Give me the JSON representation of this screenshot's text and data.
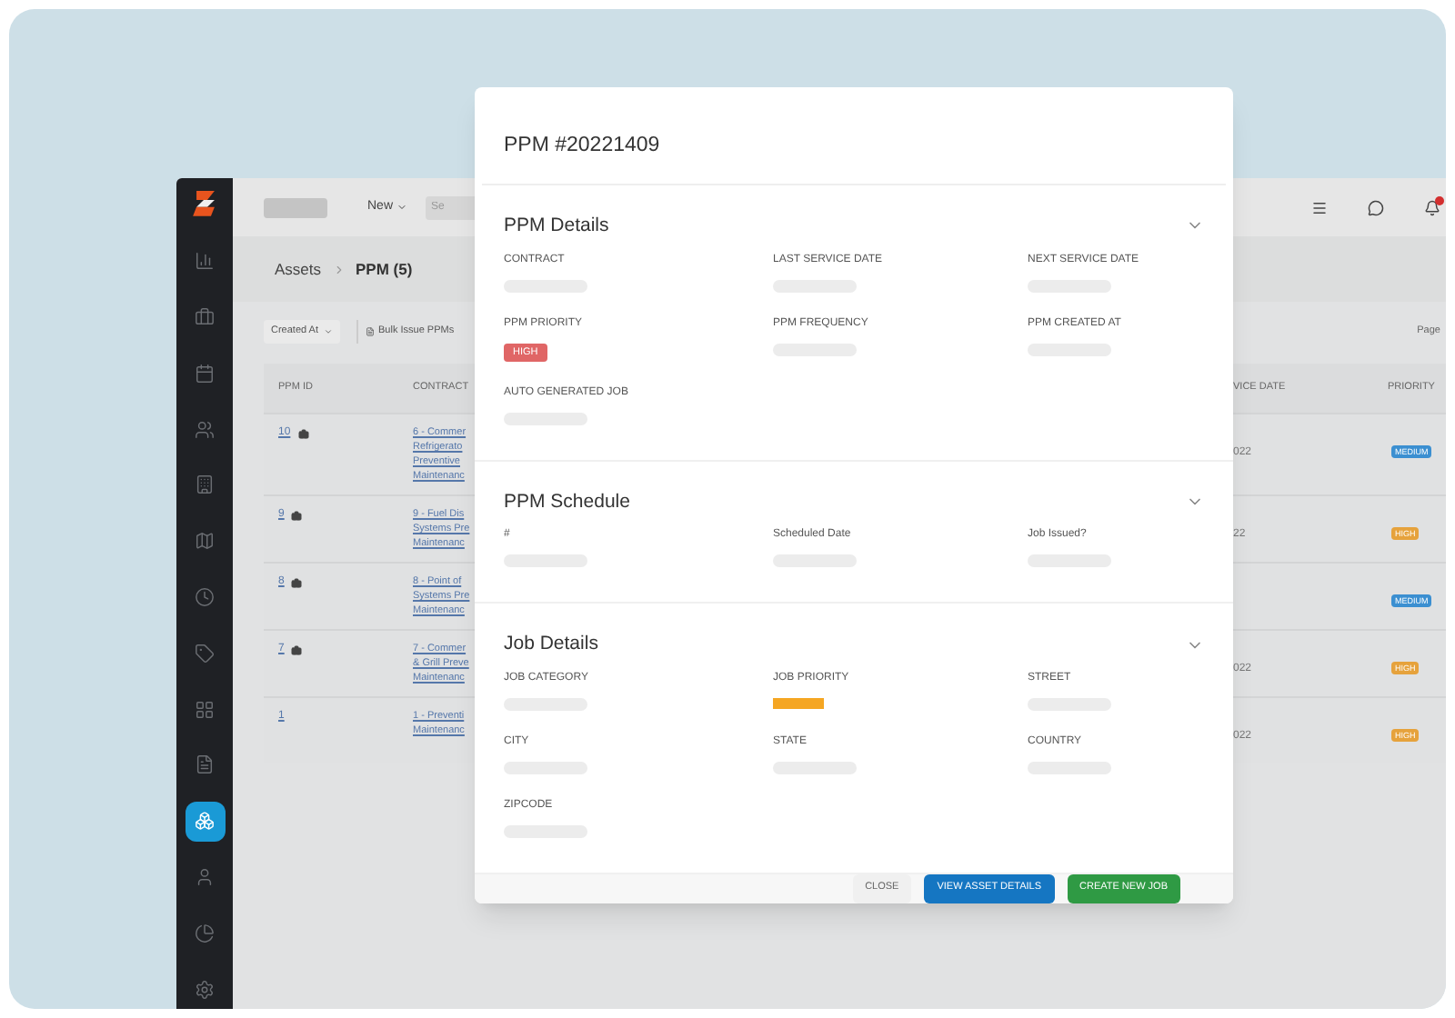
{
  "sidebar": {
    "items": [
      {
        "selected": false
      },
      {
        "selected": false
      },
      {
        "selected": false
      },
      {
        "selected": false
      },
      {
        "selected": false
      },
      {
        "selected": false
      },
      {
        "selected": false
      },
      {
        "selected": false
      },
      {
        "selected": false
      },
      {
        "selected": false
      },
      {
        "selected": true
      },
      {
        "selected": false
      },
      {
        "selected": false
      },
      {
        "selected": false
      }
    ]
  },
  "topbar": {
    "new_button": "New",
    "search": {
      "placeholder": "Se"
    }
  },
  "breadcrumb": [
    "Assets",
    "PPM (5)"
  ],
  "toolbar": {
    "filter": "Created At",
    "bulk_button": "Bulk Issue PPMs",
    "pagination_label": "Page"
  },
  "table": {
    "columns": [
      "PPM ID",
      "CONTRACT",
      "VICE DATE",
      "PRIORITY"
    ],
    "rows": [
      {
        "id": "10",
        "asset": true,
        "contract": [
          "6 - Commer",
          "Refrigerato",
          "Preventive",
          "Maintenanc"
        ],
        "date": "022",
        "priority": {
          "label": "MEDIUM",
          "color": "#3b8fd1"
        }
      },
      {
        "id": "9",
        "asset": true,
        "contract": [
          "9 - Fuel Dis",
          "Systems Pre",
          "Maintenanc"
        ],
        "date": "22",
        "priority": {
          "label": "HIGH",
          "color": "#e6a23c"
        }
      },
      {
        "id": "8",
        "asset": true,
        "contract": [
          "8 - Point of",
          "Systems Pre",
          "Maintenanc"
        ],
        "priority": {
          "label": "MEDIUM",
          "color": "#3b8fd1"
        }
      },
      {
        "id": "7",
        "asset": true,
        "contract": [
          "7 - Commer",
          "& Grill Preve",
          "Maintenanc"
        ],
        "date": "022",
        "priority": {
          "label": "HIGH",
          "color": "#e6a23c"
        }
      },
      {
        "id": "1",
        "asset": false,
        "contract": [
          "1 - Preventi",
          "Maintenanc"
        ],
        "date": "022",
        "priority": {
          "label": "HIGH",
          "color": "#e6a23c"
        }
      }
    ]
  },
  "modal": {
    "title": "PPM #20221409",
    "sections": [
      {
        "title": "PPM Details",
        "expanded": true,
        "fields": [
          {
            "label": "CONTRACT",
            "kind": "skeleton"
          },
          {
            "label": "LAST SERVICE DATE",
            "kind": "skeleton"
          },
          {
            "label": "NEXT SERVICE DATE",
            "kind": "skeleton"
          },
          {
            "label": "PPM PRIORITY",
            "kind": "tag",
            "value": "HIGH",
            "color": "#e06666"
          },
          {
            "label": "PPM FREQUENCY",
            "kind": "skeleton"
          },
          {
            "label": "PPM CREATED AT",
            "kind": "skeleton"
          },
          {
            "label": "AUTO GENERATED JOB",
            "kind": "skeleton"
          }
        ]
      },
      {
        "title": "PPM Schedule",
        "expanded": true,
        "fields": [
          {
            "label": "#",
            "kind": "skeleton"
          },
          {
            "label": "Scheduled Date",
            "kind": "skeleton"
          },
          {
            "label": "Job Issued?",
            "kind": "skeleton"
          }
        ]
      },
      {
        "title": "Job Details",
        "expanded": true,
        "fields": [
          {
            "label": "JOB CATEGORY",
            "kind": "skeleton"
          },
          {
            "label": "JOB PRIORITY",
            "kind": "bar",
            "color": "#f5a623"
          },
          {
            "label": "STREET",
            "kind": "skeleton"
          },
          {
            "label": "CITY",
            "kind": "skeleton"
          },
          {
            "label": "STATE",
            "kind": "skeleton"
          },
          {
            "label": "COUNTRY",
            "kind": "skeleton"
          },
          {
            "label": "ZIPCODE",
            "kind": "skeleton"
          }
        ]
      }
    ],
    "buttons": [
      {
        "label": "CLOSE",
        "kind": "secondary"
      },
      {
        "label": "VIEW ASSET DETAILS",
        "kind": "primary"
      },
      {
        "label": "CREATE NEW JOB",
        "kind": "success"
      }
    ]
  }
}
